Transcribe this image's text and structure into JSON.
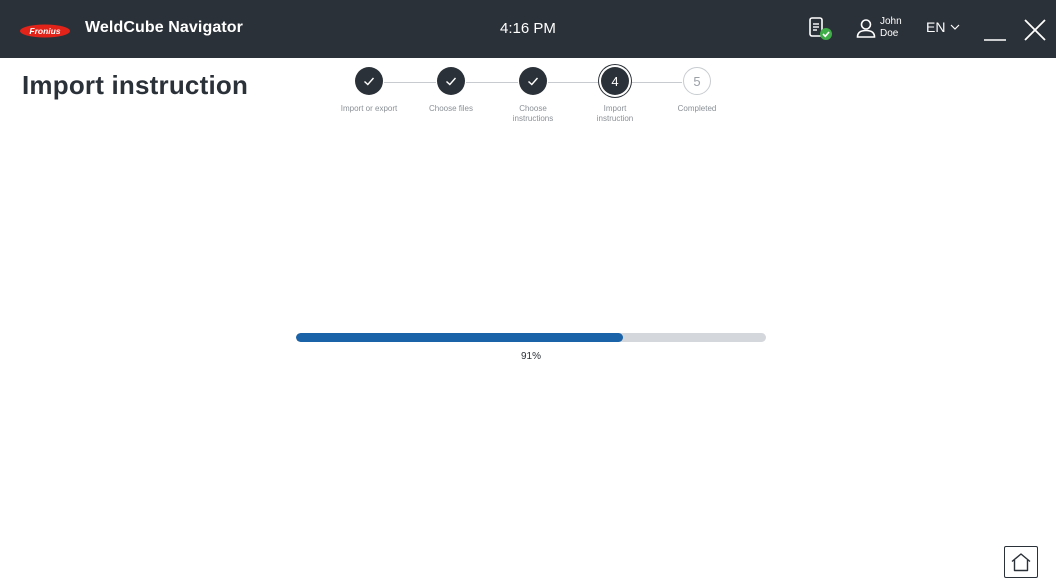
{
  "header": {
    "brand_logo_text": "Fronius",
    "app_title": "WeldCube Navigator",
    "clock": "4:16 PM",
    "device_status_icon": "device-connected-icon",
    "user": {
      "first_name": "John",
      "last_name": "Doe"
    },
    "language": "EN",
    "colors": {
      "bar": "#2b3138",
      "brand_red": "#e2231a"
    }
  },
  "page": {
    "title": "Import instruction"
  },
  "stepper": {
    "current_step": 4,
    "steps": [
      {
        "number": "1",
        "label": "Import or export",
        "state": "done"
      },
      {
        "number": "2",
        "label": "Choose files",
        "state": "done"
      },
      {
        "number": "3",
        "label": "Choose instructions",
        "state": "done"
      },
      {
        "number": "4",
        "label": "Import instruction",
        "state": "current"
      },
      {
        "number": "5",
        "label": "Completed",
        "state": "pending"
      }
    ]
  },
  "progress": {
    "value": 0.91,
    "label": "91%",
    "fill_color": "#1a63a8",
    "track_color": "#d4d7db"
  },
  "footer": {
    "home_icon": "home-icon"
  }
}
